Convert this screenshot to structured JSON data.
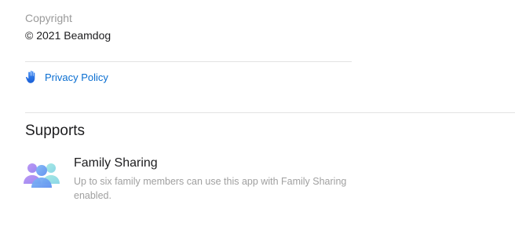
{
  "copyright": {
    "label": "Copyright",
    "value": "© 2021 Beamdog"
  },
  "privacy": {
    "link_label": "Privacy Policy",
    "icon": "hand-raised-icon",
    "link_color": "#0a6ed1"
  },
  "supports": {
    "title": "Supports",
    "features": [
      {
        "icon": "family-sharing-icon",
        "title": "Family Sharing",
        "description": "Up to six family members can use this app with Family Sharing enabled."
      }
    ]
  }
}
